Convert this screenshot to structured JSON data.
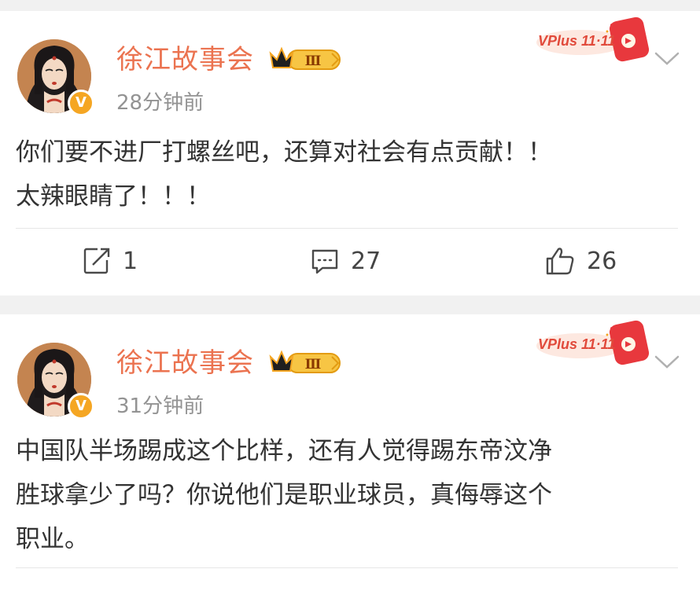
{
  "posts": [
    {
      "username": "徐江故事会",
      "vip_level": "Ⅲ",
      "verified": "V",
      "timestamp": "28分钟前",
      "promo": "VPlus 11·11",
      "text_lines": [
        "你们要不进厂打螺丝吧，还算对社会有点贡献！！",
        "太辣眼睛了！！！"
      ],
      "reposts": "1",
      "comments": "27",
      "likes": "26"
    },
    {
      "username": "徐江故事会",
      "vip_level": "Ⅲ",
      "verified": "V",
      "timestamp": "31分钟前",
      "promo": "VPlus 11·11",
      "text_lines": [
        "中国队半场踢成这个比样，还有人觉得踢东帝汶净",
        "胜球拿少了吗？你说他们是职业球员，真侮辱这个",
        "职业。"
      ]
    }
  ],
  "icons": {
    "repost": "repost-icon",
    "comment": "comment-icon",
    "like": "thumbs-up-icon",
    "more": "chevron-down-icon"
  },
  "colors": {
    "username": "#eb7350",
    "text": "#333333",
    "meta": "#939393",
    "background": "#f1f1f1",
    "vip_gold": "#f5a623"
  }
}
